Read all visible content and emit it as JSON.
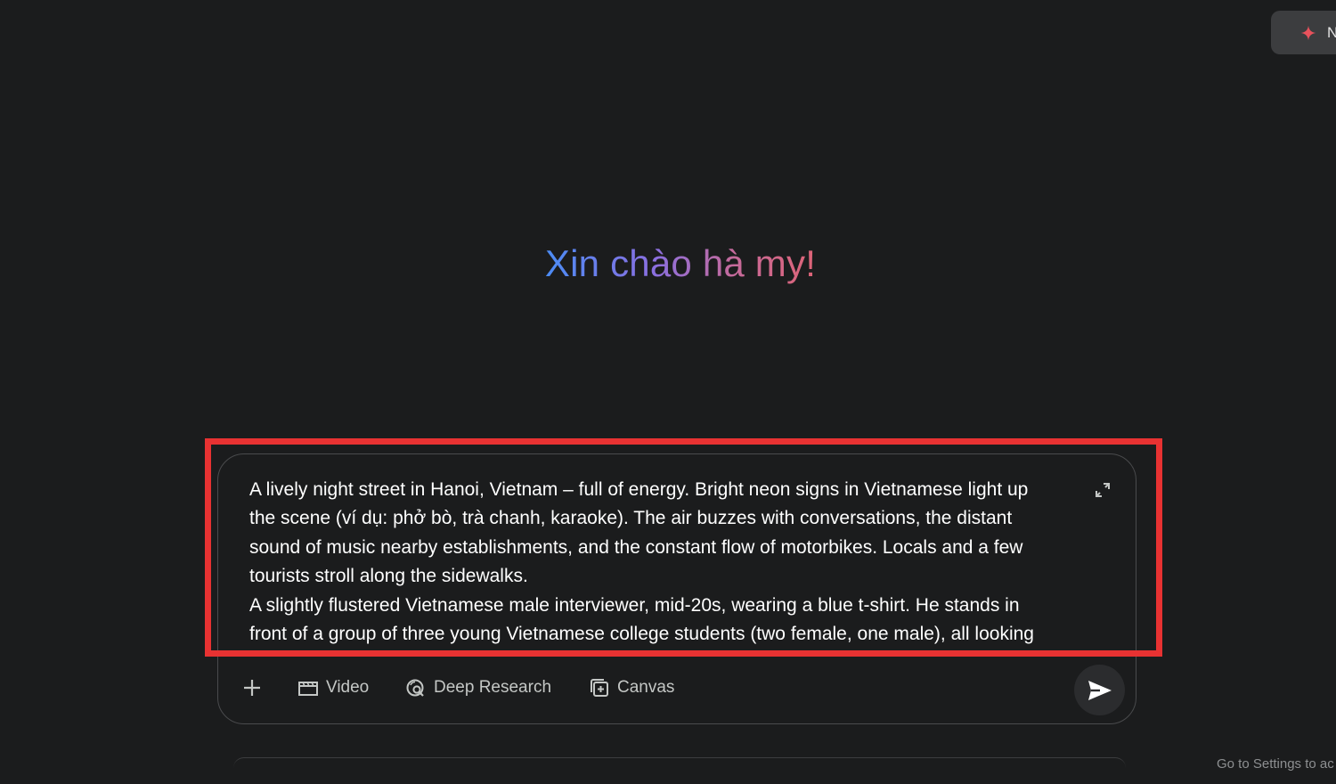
{
  "header": {
    "pill_label": "N",
    "pill_icon": "sparkle-icon",
    "pill_icon_color": "#e8525c"
  },
  "greeting": {
    "text": "Xin chào hà my!"
  },
  "composer": {
    "prompt_text": "A lively night street in Hanoi, Vietnam – full of energy. Bright neon signs in Vietnamese light up\nthe scene (ví dụ: phở bò, trà chanh, karaoke). The air buzzes with conversations, the distant\nsound of music nearby establishments, and the constant flow of motorbikes. Locals and a few\ntourists stroll along the sidewalks.\nA slightly flustered Vietnamese male interviewer, mid-20s, wearing a blue t-shirt. He stands in\nfront of a group of three young Vietnamese college students (two female, one male), all looking",
    "tools": {
      "video_label": "Video",
      "deep_research_label": "Deep Research",
      "canvas_label": "Canvas"
    }
  },
  "annotation": {
    "highlight_color": "#e83232"
  },
  "watermark": {
    "text": "Go to Settings to ac"
  }
}
